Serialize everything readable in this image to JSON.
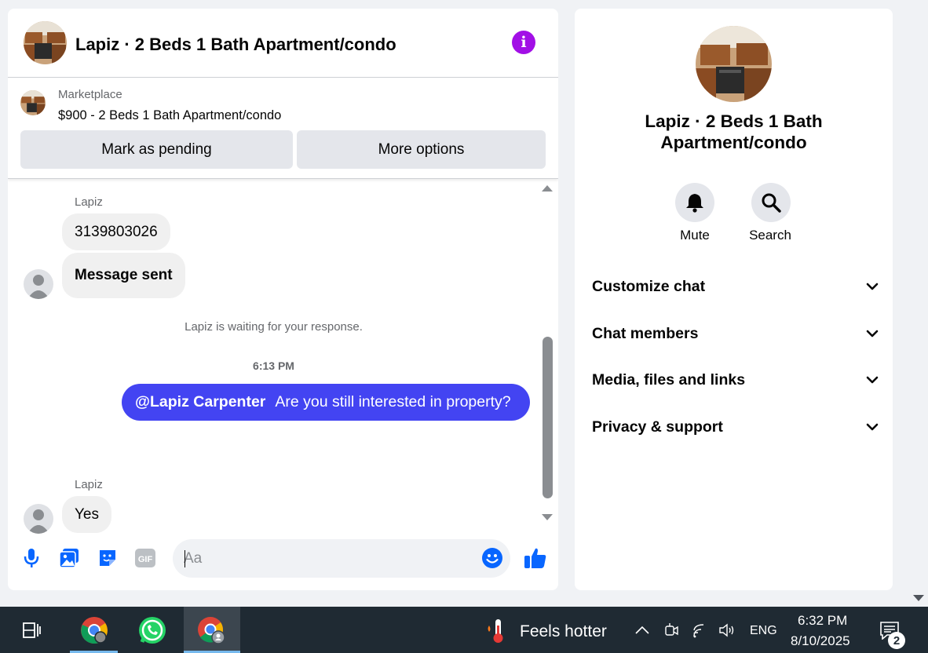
{
  "chat": {
    "title": "Lapiz · 2 Beds 1 Bath Apartment/condo",
    "icons": {
      "info": "info-icon"
    },
    "listing": {
      "category": "Marketplace",
      "title": "$900 - 2 Beds 1 Bath Apartment/condo",
      "mark_pending_label": "Mark as pending",
      "more_options_label": "More options"
    },
    "messages": {
      "sender_1": "Lapiz",
      "bubble_phone": "3139803026",
      "bubble_sent": "Message sent",
      "status": "Lapiz is waiting for your response.",
      "timestamp": "6:13 PM",
      "outgoing_mention": "@Lapiz Carpenter",
      "outgoing_text": "Are you still interested in property?",
      "sender_2": "Lapiz",
      "bubble_yes": "Yes"
    },
    "composer": {
      "placeholder": "Aa",
      "value": "",
      "icons": [
        "microphone-icon",
        "image-icon",
        "sticker-icon",
        "gif-icon",
        "emoji-icon",
        "thumbs-up-icon"
      ],
      "gif_label": "GIF"
    },
    "accent_color": "#4344f2",
    "info_color": "#a20fe6"
  },
  "info_panel": {
    "title": "Lapiz · 2 Beds 1 Bath Apartment/condo",
    "mute_label": "Mute",
    "search_label": "Search",
    "sections": [
      {
        "label": "Customize chat"
      },
      {
        "label": "Chat members"
      },
      {
        "label": "Media, files and links"
      },
      {
        "label": "Privacy & support"
      }
    ]
  },
  "taskbar": {
    "apps": [
      "chrome",
      "whatsapp",
      "chrome-profile"
    ],
    "weather": "Feels hotter",
    "language": "ENG",
    "time": "6:32 PM",
    "date": "8/10/2025",
    "notifications": "2"
  }
}
